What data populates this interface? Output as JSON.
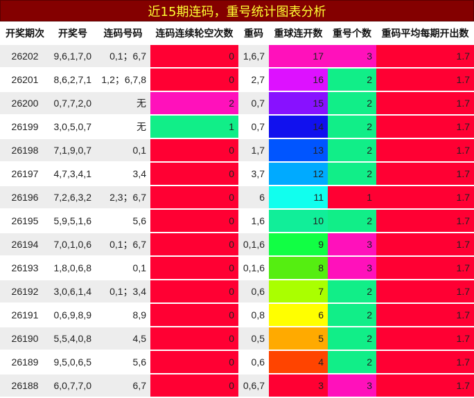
{
  "title": "近15期连码，重号统计图表分析",
  "headers": [
    "开奖期次",
    "开奖号",
    "连码号码",
    "连码连续轮空次数",
    "重码",
    "重球连开数",
    "重号个数",
    "重码平均每期开出数"
  ],
  "rows": [
    {
      "period": "26202",
      "numbers": "9,6,1,7,0",
      "consec": "0,1；6,7",
      "miss": "0",
      "repeat": "1,6,7",
      "streak": "17",
      "count": "3",
      "avg": "1.7"
    },
    {
      "period": "26201",
      "numbers": "8,6,2,7,1",
      "consec": "1,2；6,7,8",
      "miss": "0",
      "repeat": "2,7",
      "streak": "16",
      "count": "2",
      "avg": "1.7"
    },
    {
      "period": "26200",
      "numbers": "0,7,7,2,0",
      "consec": "无",
      "miss": "2",
      "repeat": "0,7",
      "streak": "15",
      "count": "2",
      "avg": "1.7"
    },
    {
      "period": "26199",
      "numbers": "3,0,5,0,7",
      "consec": "无",
      "miss": "1",
      "repeat": "0,7",
      "streak": "14",
      "count": "2",
      "avg": "1.7"
    },
    {
      "period": "26198",
      "numbers": "7,1,9,0,7",
      "consec": "0,1",
      "miss": "0",
      "repeat": "1,7",
      "streak": "13",
      "count": "2",
      "avg": "1.7"
    },
    {
      "period": "26197",
      "numbers": "4,7,3,4,1",
      "consec": "3,4",
      "miss": "0",
      "repeat": "3,7",
      "streak": "12",
      "count": "2",
      "avg": "1.7"
    },
    {
      "period": "26196",
      "numbers": "7,2,6,3,2",
      "consec": "2,3；6,7",
      "miss": "0",
      "repeat": "6",
      "streak": "11",
      "count": "1",
      "avg": "1.7"
    },
    {
      "period": "26195",
      "numbers": "5,9,5,1,6",
      "consec": "5,6",
      "miss": "0",
      "repeat": "1,6",
      "streak": "10",
      "count": "2",
      "avg": "1.7"
    },
    {
      "period": "26194",
      "numbers": "7,0,1,0,6",
      "consec": "0,1；6,7",
      "miss": "0",
      "repeat": "0,1,6",
      "streak": "9",
      "count": "3",
      "avg": "1.7"
    },
    {
      "period": "26193",
      "numbers": "1,8,0,6,8",
      "consec": "0,1",
      "miss": "0",
      "repeat": "0,1,6",
      "streak": "8",
      "count": "3",
      "avg": "1.7"
    },
    {
      "period": "26192",
      "numbers": "3,0,6,1,4",
      "consec": "0,1；3,4",
      "miss": "0",
      "repeat": "0,6",
      "streak": "7",
      "count": "2",
      "avg": "1.7"
    },
    {
      "period": "26191",
      "numbers": "0,6,9,8,9",
      "consec": "8,9",
      "miss": "0",
      "repeat": "0,8",
      "streak": "6",
      "count": "2",
      "avg": "1.7"
    },
    {
      "period": "26190",
      "numbers": "5,5,4,0,8",
      "consec": "4,5",
      "miss": "0",
      "repeat": "0,5",
      "streak": "5",
      "count": "2",
      "avg": "1.7"
    },
    {
      "period": "26189",
      "numbers": "9,5,0,6,5",
      "consec": "5,6",
      "miss": "0",
      "repeat": "0,6",
      "streak": "4",
      "count": "2",
      "avg": "1.7"
    },
    {
      "period": "26188",
      "numbers": "6,0,7,7,0",
      "consec": "6,7",
      "miss": "0",
      "repeat": "0,6,7",
      "streak": "3",
      "count": "3",
      "avg": "1.7"
    }
  ],
  "colors": {
    "title_bg": "#840000",
    "title_text": "#ffff33",
    "miss": {
      "0": "#ff0033",
      "1": "#11ee88",
      "2": "#ff11bb"
    },
    "count": {
      "1": "#ff0033",
      "2": "#11ee88",
      "3": "#ff11bb"
    },
    "avg_bg": "#ff0033",
    "streak": {
      "17": "#ff11bb",
      "16": "#dd11ff",
      "15": "#8811ff",
      "14": "#1111ee",
      "13": "#0055ff",
      "12": "#00aaff",
      "11": "#11ffee",
      "10": "#11ee99",
      "9": "#11ff44",
      "8": "#55ee11",
      "7": "#aaff00",
      "6": "#ffff00",
      "5": "#ffaa00",
      "4": "#ff4400",
      "3": "#ff0033"
    },
    "dark_text_streak": [
      "11",
      "10",
      "9",
      "8",
      "7",
      "6",
      "5"
    ],
    "dark_text_miss": [
      "1"
    ],
    "dark_text_count": [
      "2"
    ]
  }
}
